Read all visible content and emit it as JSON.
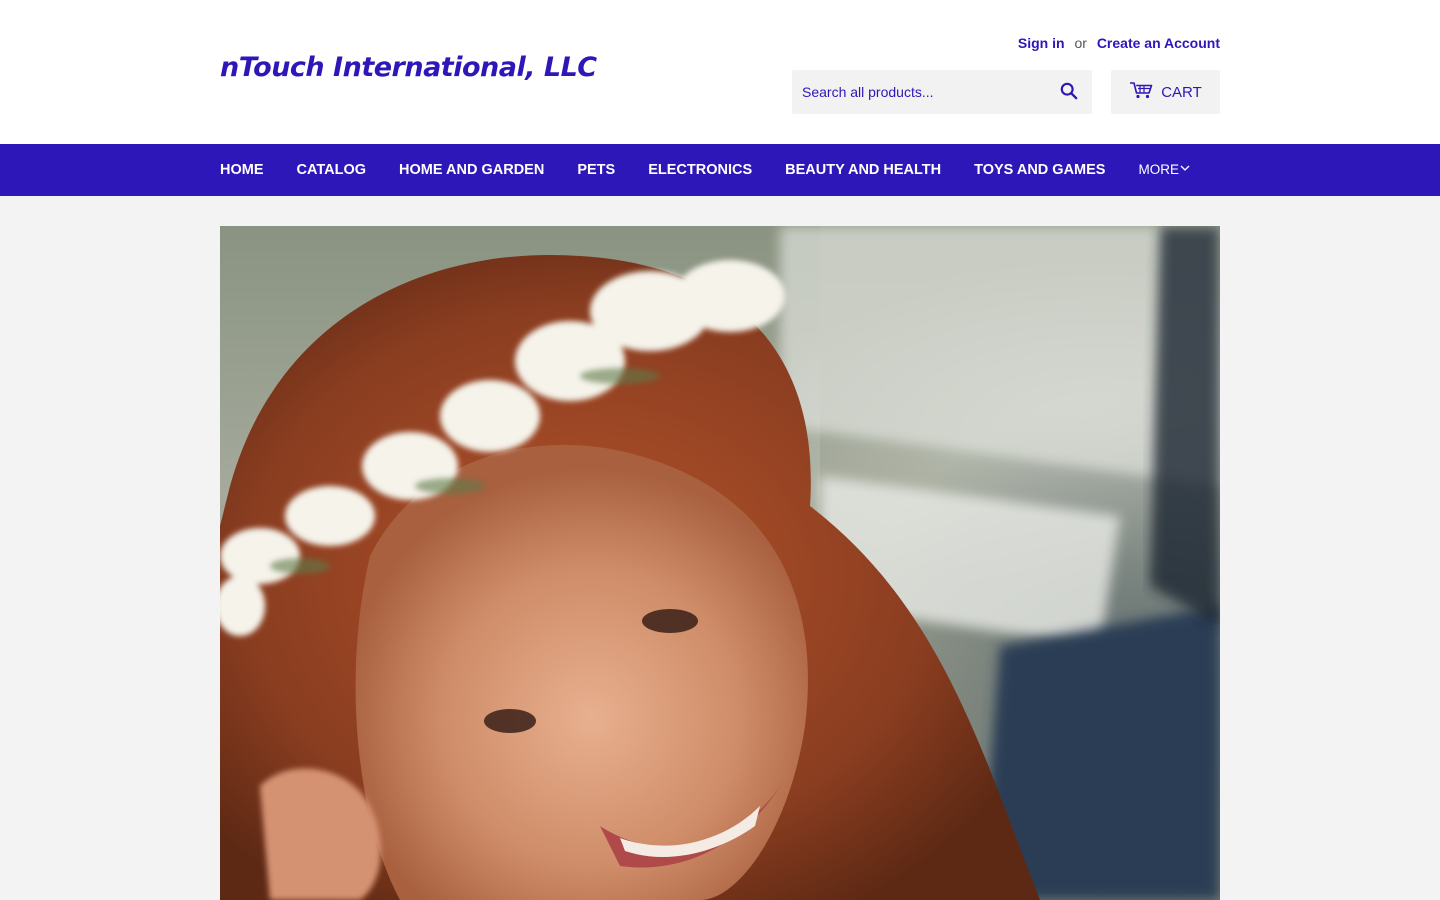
{
  "brand": {
    "logo_text": "nTouch International, LLC"
  },
  "account": {
    "sign_in": "Sign in",
    "or": "or",
    "create_account": "Create an Account"
  },
  "search": {
    "placeholder": "Search all products..."
  },
  "cart": {
    "label": "CART"
  },
  "nav": {
    "items": [
      {
        "label": "HOME"
      },
      {
        "label": "CATALOG"
      },
      {
        "label": "HOME AND GARDEN"
      },
      {
        "label": "PETS"
      },
      {
        "label": "ELECTRONICS"
      },
      {
        "label": "BEAUTY AND HEALTH"
      },
      {
        "label": "TOYS AND GAMES"
      }
    ],
    "more_label": "MORE"
  },
  "colors": {
    "accent": "#2e17b8",
    "header_bg": "#ffffff",
    "page_bg": "#f3f3f3"
  },
  "hero": {
    "icon": "hero-photo"
  }
}
